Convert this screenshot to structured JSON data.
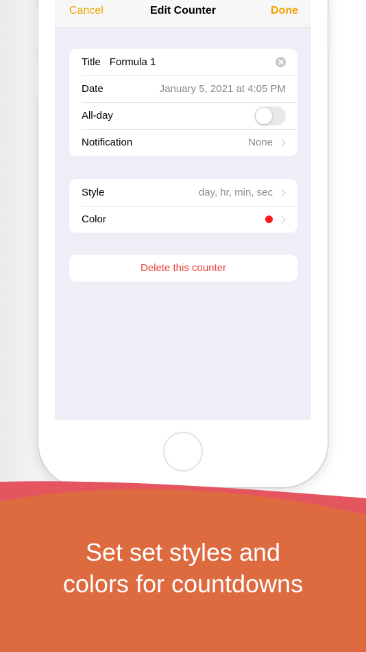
{
  "navbar": {
    "cancel_label": "Cancel",
    "title": "Edit Counter",
    "done_label": "Done"
  },
  "event_group": {
    "title_label": "Title",
    "title_value": "Formula 1",
    "date_label": "Date",
    "date_value": "January 5, 2021 at 4:05 PM",
    "allday_label": "All-day",
    "allday_enabled": false,
    "notification_label": "Notification",
    "notification_value": "None"
  },
  "style_group": {
    "style_label": "Style",
    "style_value": "day, hr, min, sec",
    "color_label": "Color",
    "color_value": "#ff1a1a"
  },
  "delete_label": "Delete this counter",
  "caption": {
    "line1": "Set set styles and",
    "line2": "colors for countdowns"
  },
  "colors": {
    "accent": "#f0a400",
    "destructive": "#e8413a",
    "banner": "#de6a40"
  }
}
